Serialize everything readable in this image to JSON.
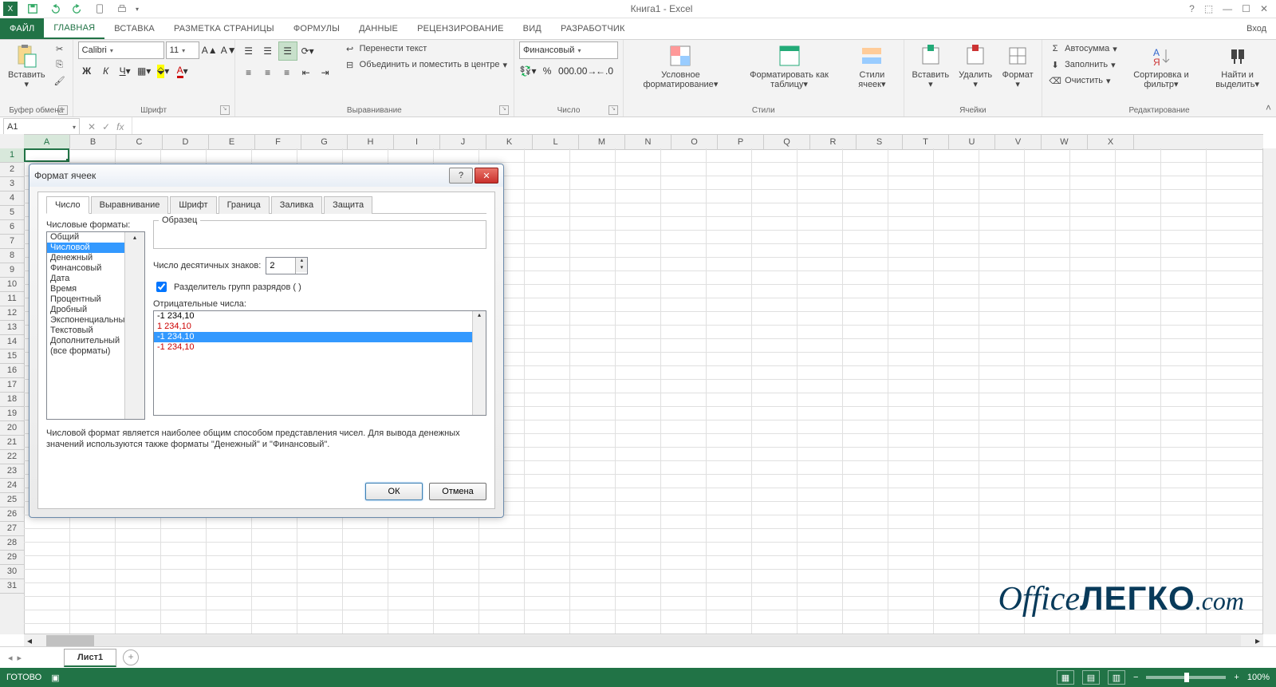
{
  "app": {
    "title": "Книга1 - Excel",
    "signin": "Вход"
  },
  "qat": [
    "save",
    "undo",
    "redo",
    "touch",
    "print"
  ],
  "tabs": {
    "file": "ФАЙЛ",
    "home": "ГЛАВНАЯ",
    "insert": "ВСТАВКА",
    "layout": "РАЗМЕТКА СТРАНИЦЫ",
    "formulas": "ФОРМУЛЫ",
    "data": "ДАННЫЕ",
    "review": "РЕЦЕНЗИРОВАНИЕ",
    "view": "ВИД",
    "dev": "РАЗРАБОТЧИК"
  },
  "ribbon": {
    "clipboard": {
      "label": "Буфер обмена",
      "paste": "Вставить"
    },
    "font": {
      "label": "Шрифт",
      "name": "Calibri",
      "size": "11"
    },
    "align": {
      "label": "Выравнивание",
      "wrap": "Перенести текст",
      "merge": "Объединить и поместить в центре"
    },
    "number": {
      "label": "Число",
      "format": "Финансовый"
    },
    "styles": {
      "label": "Стили",
      "cond": "Условное форматирование",
      "table": "Форматировать как таблицу",
      "cell": "Стили ячеек"
    },
    "cells": {
      "label": "Ячейки",
      "insert": "Вставить",
      "delete": "Удалить",
      "format": "Формат"
    },
    "editing": {
      "label": "Редактирование",
      "sum": "Автосумма",
      "fill": "Заполнить",
      "clear": "Очистить",
      "sort": "Сортировка и фильтр",
      "find": "Найти и выделить"
    }
  },
  "namebox": "A1",
  "columns": [
    "A",
    "B",
    "C",
    "D",
    "E",
    "F",
    "G",
    "H",
    "I",
    "J",
    "K",
    "L",
    "M",
    "N",
    "O",
    "P",
    "Q",
    "R",
    "S",
    "T",
    "U",
    "V",
    "W",
    "X"
  ],
  "rows": [
    "1",
    "2",
    "3",
    "4",
    "5",
    "6",
    "7",
    "8",
    "9",
    "10",
    "11",
    "12",
    "13",
    "14",
    "15",
    "16",
    "17",
    "18",
    "19",
    "20",
    "21",
    "22",
    "23",
    "24",
    "25",
    "26",
    "27",
    "28",
    "29",
    "30",
    "31"
  ],
  "sheet": "Лист1",
  "status": {
    "ready": "ГОТОВО",
    "zoom": "100%"
  },
  "dialog": {
    "title": "Формат ячеек",
    "tabs": {
      "number": "Число",
      "align": "Выравнивание",
      "font": "Шрифт",
      "border": "Граница",
      "fill": "Заливка",
      "protect": "Защита"
    },
    "formats_label": "Числовые форматы:",
    "formats": [
      "Общий",
      "Числовой",
      "Денежный",
      "Финансовый",
      "Дата",
      "Время",
      "Процентный",
      "Дробный",
      "Экспоненциальный",
      "Текстовый",
      "Дополнительный",
      "(все форматы)"
    ],
    "selected_format_index": 1,
    "sample_label": "Образец",
    "decimals_label": "Число десятичных знаков:",
    "decimals_value": "2",
    "thousands_label": "Разделитель групп разрядов ( )",
    "thousands_checked": true,
    "negatives_label": "Отрицательные числа:",
    "negatives": [
      "-1 234,10",
      "1 234,10",
      "-1 234,10",
      "-1 234,10"
    ],
    "negatives_selected": 2,
    "description": "Числовой формат является наиболее общим способом представления чисел. Для вывода денежных значений используются также форматы \"Денежный\" и \"Финансовый\".",
    "ok": "ОК",
    "cancel": "Отмена"
  },
  "watermark": "OfficeЛЕГКО.com"
}
